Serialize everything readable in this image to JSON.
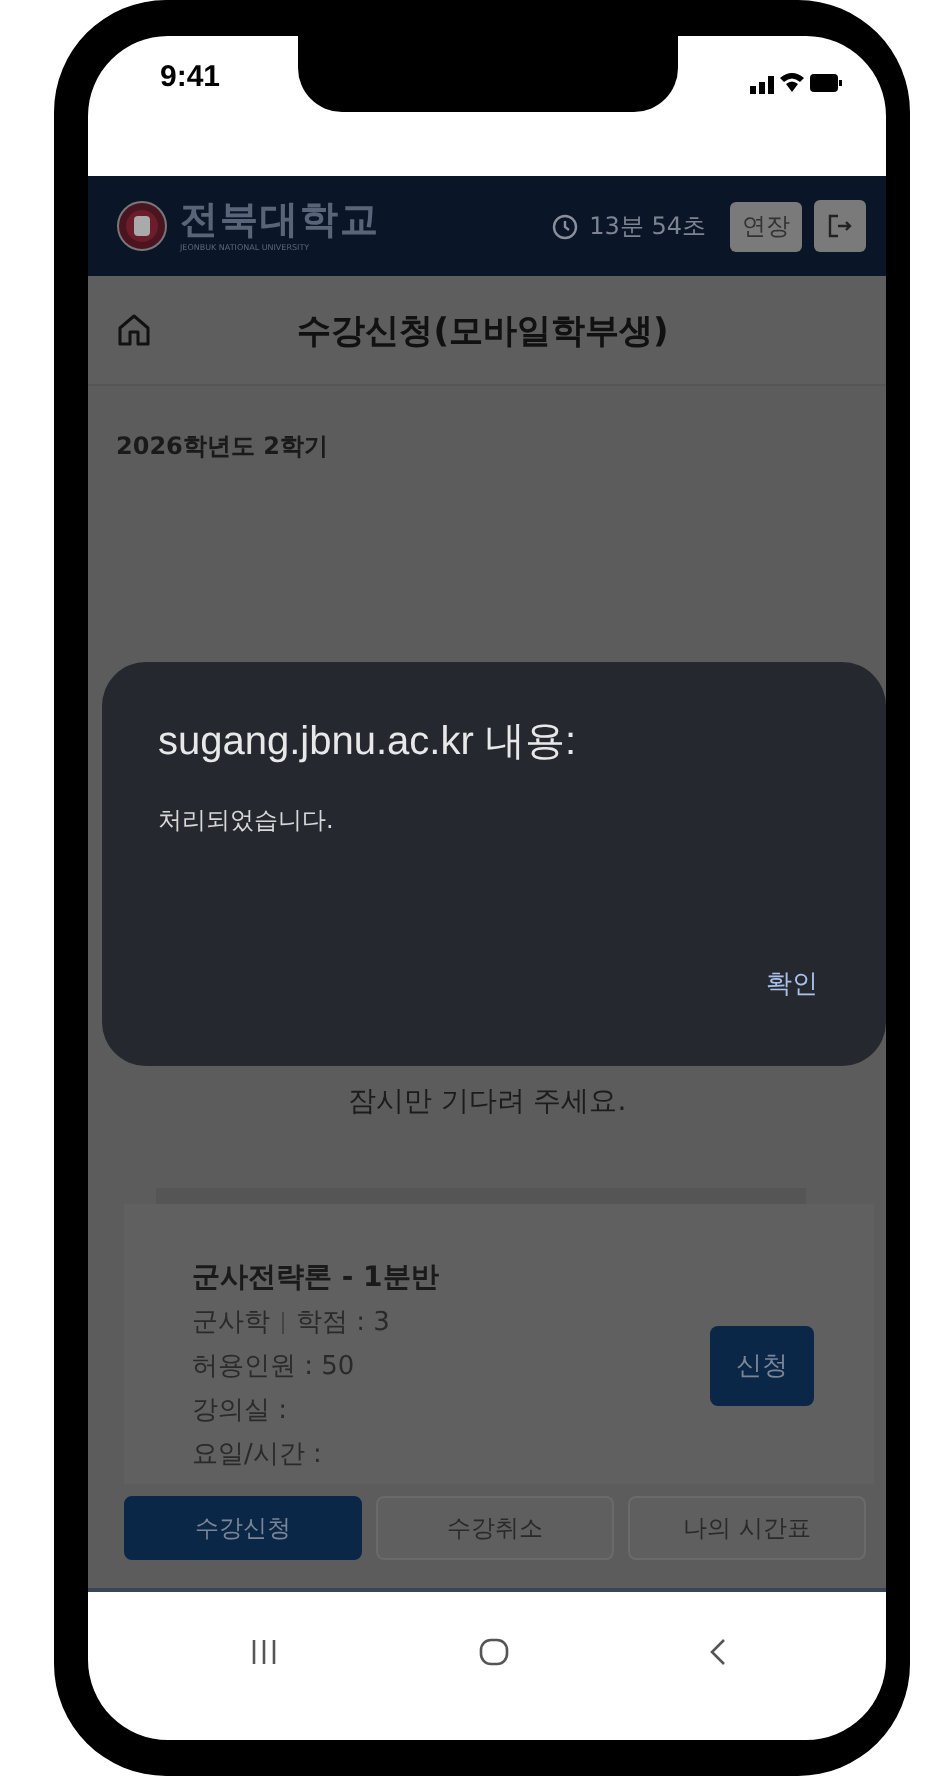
{
  "status_bar": {
    "time": "9:41"
  },
  "header": {
    "university": "전북대학교",
    "university_subtitle": "JEONBUK NATIONAL UNIVERSITY",
    "timer": "13분 54초",
    "extend_button": "연장"
  },
  "page_title": "수강신청(모바일학부생)",
  "semester": "2026학년도 2학기",
  "dialog": {
    "title": "sugang.jbnu.ac.kr 내용:",
    "message": "처리되었습니다.",
    "ok_button": "확인"
  },
  "waiting_message": "잠시만 기다려 주세요.",
  "course": {
    "title": "군사전략론 - 1분반",
    "department": "군사학",
    "credits": "학점 : 3",
    "capacity": "허용인원 : 50",
    "room": "강의실 :",
    "schedule": "요일/시간 :",
    "apply_button": "신청"
  },
  "bottom_tabs": [
    {
      "label": "수강신청",
      "selected": true
    },
    {
      "label": "수강취소",
      "selected": false
    },
    {
      "label": "나의 시간표",
      "selected": false
    }
  ]
}
